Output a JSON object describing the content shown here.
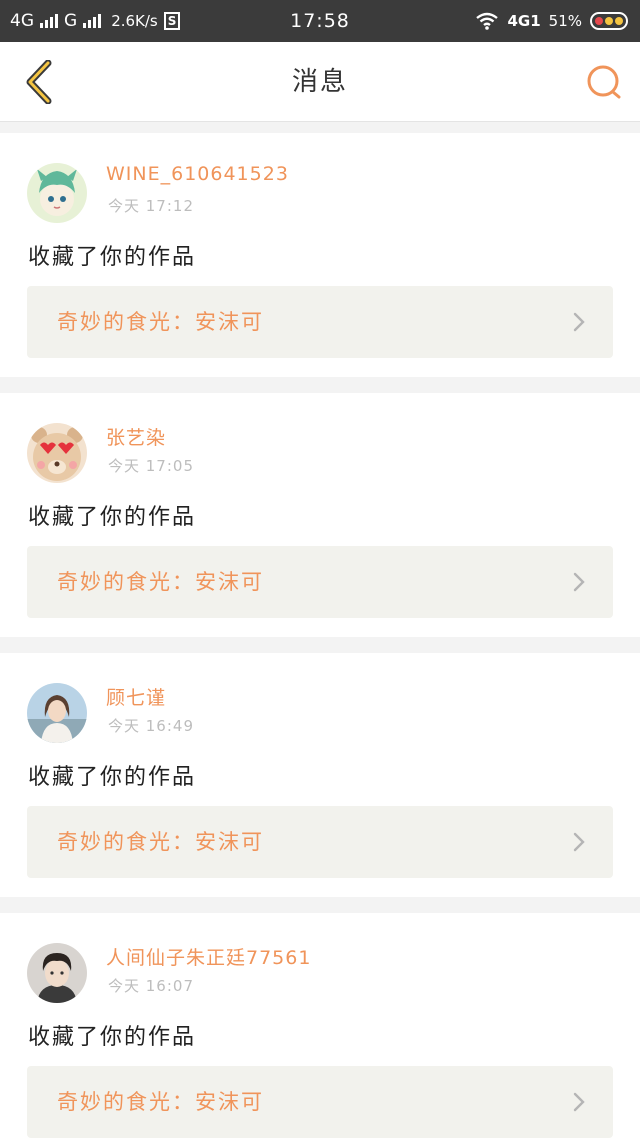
{
  "status_bar": {
    "network1": "4G",
    "network2": "G",
    "speed": "2.6K/s",
    "s_badge": "S",
    "time": "17:58",
    "network3": "4G1",
    "battery_percent": "51%",
    "battery_dot_colors": [
      "#e5484d",
      "#f5c542",
      "#f5c542"
    ]
  },
  "nav": {
    "title": "消息"
  },
  "accent_color": "#f0945a",
  "notifications": [
    {
      "username": "WINE_610641523",
      "time": "今天 17:12",
      "action": "收藏了你的作品",
      "work_title": "奇妙的食光：安沫可",
      "avatar_icon": "anime-avatar-icon"
    },
    {
      "username": "张艺染",
      "time": "今天 17:05",
      "action": "收藏了你的作品",
      "work_title": "奇妙的食光：安沫可",
      "avatar_icon": "bear-emoji-avatar-icon"
    },
    {
      "username": "顾七谨",
      "time": "今天 16:49",
      "action": "收藏了你的作品",
      "work_title": "奇妙的食光：安沫可",
      "avatar_icon": "photo-avatar-icon"
    },
    {
      "username": "人间仙子朱正廷77561",
      "time": "今天 16:07",
      "action": "收藏了你的作品",
      "work_title": "奇妙的食光：安沫可",
      "avatar_icon": "photo-avatar-icon"
    }
  ]
}
